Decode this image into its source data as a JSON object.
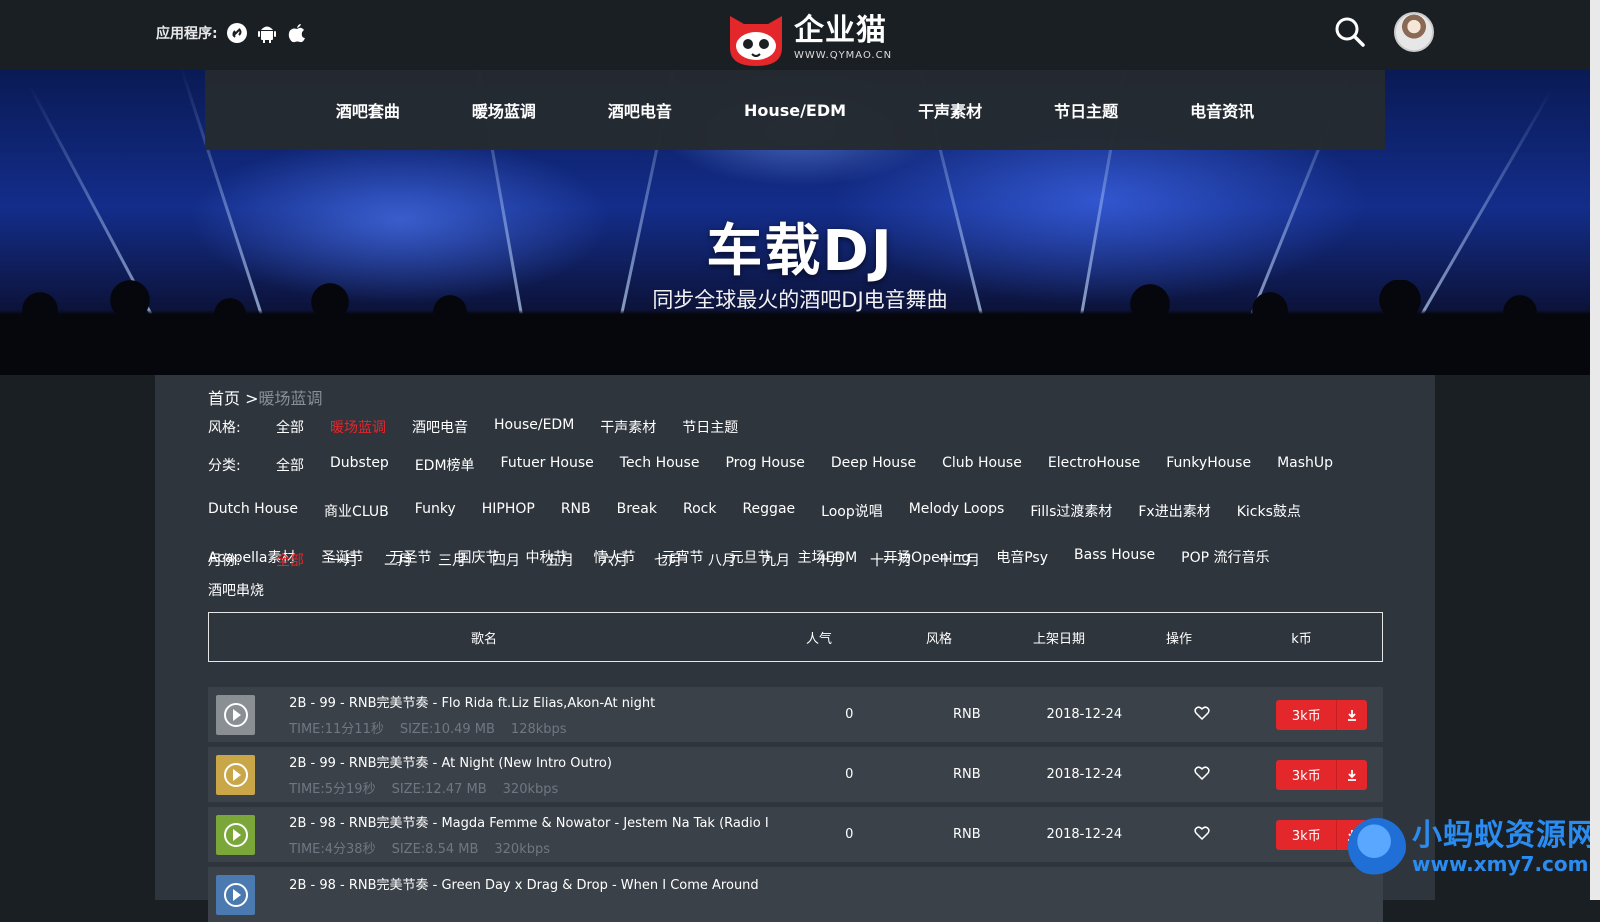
{
  "header": {
    "apps_label": "应用程序:",
    "app_icons": [
      "link-icon",
      "android-icon",
      "apple-icon"
    ],
    "logo_cn": "企业猫",
    "logo_en": "WWW.QYMAO.CN"
  },
  "nav": [
    "酒吧套曲",
    "暖场蓝调",
    "酒吧电音",
    "House/EDM",
    "干声素材",
    "节日主题",
    "电音资讯"
  ],
  "hero": {
    "title": "车载DJ",
    "subtitle": "同步全球最火的酒吧DJ电音舞曲"
  },
  "breadcrumb": {
    "home": "首页 >",
    "current": "暖场蓝调"
  },
  "filters": {
    "style_label": "风格:",
    "styles": [
      "全部",
      "暖场蓝调",
      "酒吧电音",
      "House/EDM",
      "干声素材",
      "节日主题"
    ],
    "style_active": "暖场蓝调",
    "category_label": "分类:",
    "categories": [
      "全部",
      "Dubstep",
      "EDM榜单",
      "Futuer House",
      "Tech House",
      "Prog House",
      "Deep House",
      "Club House",
      "ElectroHouse",
      "FunkyHouse",
      "MashUp",
      "Dutch House",
      "商业CLUB",
      "Funky",
      "HIPHOP",
      "RNB",
      "Break",
      "Rock",
      "Reggae",
      "Loop说唱",
      "Melody Loops",
      "Fills过渡素材",
      "Fx进出素材",
      "Kicks鼓点",
      "Acapella素材",
      "圣诞节",
      "万圣节",
      "国庆节",
      "中秋节",
      "情人节",
      "元宵节",
      "元旦节",
      "主场EDM",
      "开场Opening",
      "电音Psy",
      "Bass House",
      "POP 流行音乐",
      "酒吧串烧"
    ],
    "month_label": "月份:",
    "months": [
      "全部",
      "一月",
      "二月",
      "三月",
      "四月",
      "五月",
      "六月",
      "七月",
      "八月",
      "九月",
      "十月",
      "十一月",
      "十二月"
    ],
    "month_active": "全部"
  },
  "table": {
    "headers": [
      "歌名",
      "人气",
      "风格",
      "上架日期",
      "操作",
      "k币"
    ],
    "rows": [
      {
        "title": "2B - 99 - RNB完美节奏 - Flo Rida ft.Liz Elias,Akon-At night",
        "time": "TIME:11分11秒",
        "size": "SIZE:10.49 MB",
        "bitrate": "128kbps",
        "popularity": "0",
        "style": "RNB",
        "date": "2018-12-24",
        "price": "3k币"
      },
      {
        "title": "2B - 99 - RNB完美节奏 - At Night (New Intro Outro)",
        "time": "TIME:5分19秒",
        "size": "SIZE:12.47 MB",
        "bitrate": "320kbps",
        "popularity": "0",
        "style": "RNB",
        "date": "2018-12-24",
        "price": "3k币"
      },
      {
        "title": "2B - 98 - RNB完美节奏 - Magda Femme & Nowator - Jestem Na Tak (Radio I",
        "time": "TIME:4分38秒",
        "size": "SIZE:8.54 MB",
        "bitrate": "320kbps",
        "popularity": "0",
        "style": "RNB",
        "date": "2018-12-24",
        "price": "3k币"
      },
      {
        "title": "2B - 98 - RNB完美节奏 - Green Day x Drag & Drop - When I Come Around",
        "time": "",
        "size": "",
        "bitrate": "",
        "popularity": "",
        "style": "",
        "date": "",
        "price": ""
      }
    ]
  },
  "watermark": {
    "cn": "小蚂蚁资源网",
    "url": "www.xmy7.com"
  },
  "colors": {
    "accent": "#e3272b",
    "bg": "#1a1f24",
    "panel": "#2f353c",
    "row": "#3a4148"
  }
}
